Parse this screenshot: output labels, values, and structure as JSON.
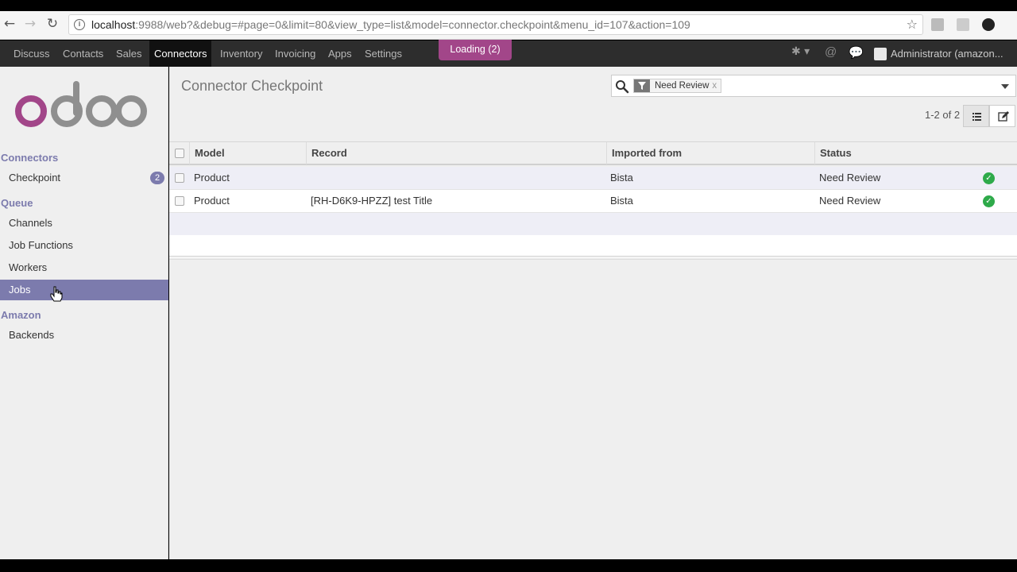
{
  "browser": {
    "url_host": "localhost",
    "url_rest": ":9988/web?&debug=#page=0&limit=80&view_type=list&model=connector.checkpoint&menu_id=107&action=109"
  },
  "topmenu": {
    "items": [
      "Discuss",
      "Contacts",
      "Sales",
      "Connectors",
      "Inventory",
      "Invoicing",
      "Apps",
      "Settings"
    ],
    "active": "Connectors",
    "loading": "Loading (2)",
    "user": "Administrator (amazon..."
  },
  "sidebar": {
    "connectors_head": "Connectors",
    "checkpoint": "Checkpoint",
    "checkpoint_badge": "2",
    "queue_head": "Queue",
    "channels": "Channels",
    "job_functions": "Job Functions",
    "workers": "Workers",
    "jobs": "Jobs",
    "amazon_head": "Amazon",
    "backends": "Backends"
  },
  "main": {
    "title": "Connector Checkpoint",
    "facet_label": "Need Review",
    "facet_remove": "x",
    "pager": "1-2 of 2",
    "columns": [
      "Model",
      "Record",
      "Imported from",
      "Status"
    ],
    "rows": [
      {
        "model": "Product",
        "record": "",
        "imported_from": "Bista",
        "status": "Need Review"
      },
      {
        "model": "Product",
        "record": "[RH-D6K9-HPZZ] test Title",
        "imported_from": "Bista",
        "status": "Need Review"
      }
    ]
  },
  "colors": {
    "brand": "#a24689",
    "sidebar_accent": "#7c7bad",
    "status_ok": "#2eaa4a"
  }
}
